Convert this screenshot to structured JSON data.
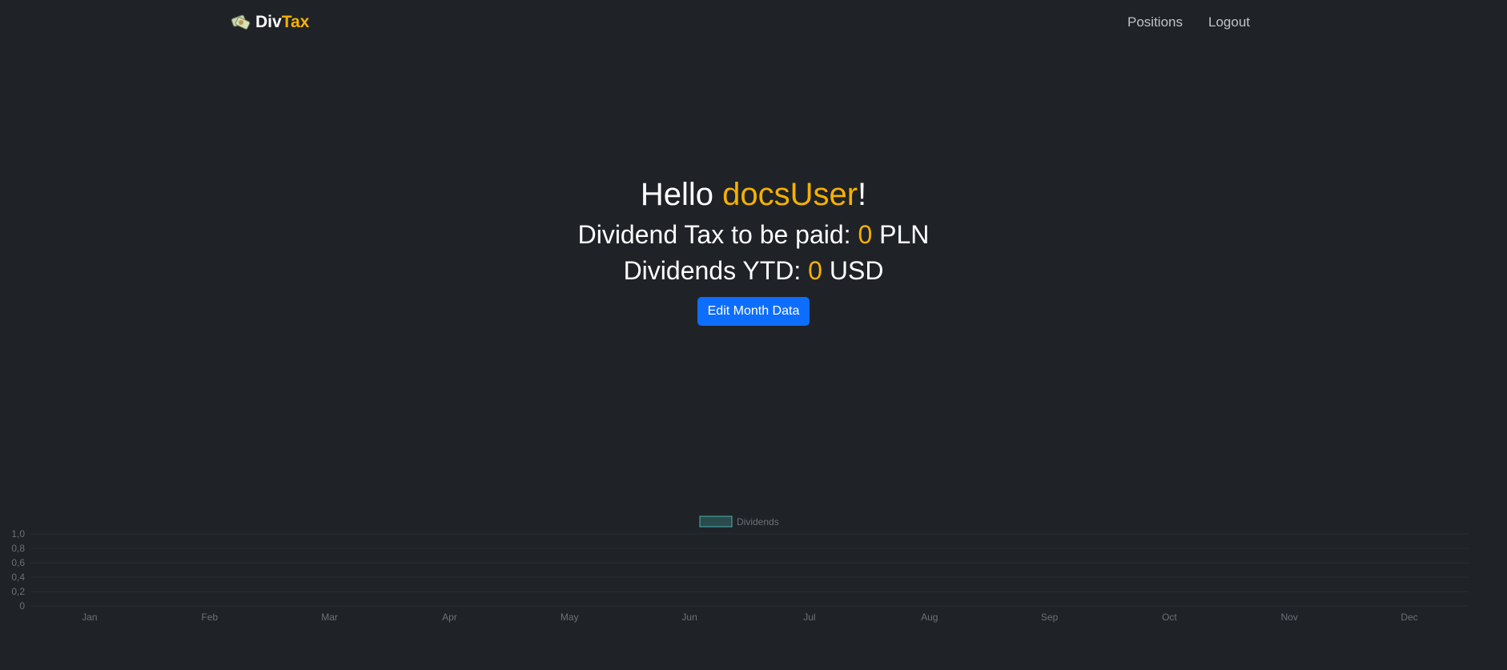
{
  "navbar": {
    "brand_part1": "Div",
    "brand_part2": "Tax",
    "logo_icon": "money-bundle-icon",
    "links": [
      {
        "label": "Positions"
      },
      {
        "label": "Logout"
      }
    ]
  },
  "hero": {
    "greeting_prefix": "Hello ",
    "username": "docsUser",
    "greeting_suffix": "!",
    "tax_prefix": "Dividend Tax to be paid: ",
    "tax_value": "0",
    "tax_currency": " PLN",
    "ytd_prefix": "Dividends YTD: ",
    "ytd_value": "0",
    "ytd_currency": " USD",
    "edit_button": "Edit Month Data"
  },
  "colors": {
    "background": "#1f2227",
    "accent": "#f5b100",
    "primary_button": "#0d6efd",
    "series_border": "#4bb3b3",
    "series_fill": "#2a4a4c"
  },
  "chart_data": {
    "type": "bar",
    "categories": [
      "Jan",
      "Feb",
      "Mar",
      "Apr",
      "May",
      "Jun",
      "Jul",
      "Aug",
      "Sep",
      "Oct",
      "Nov",
      "Dec"
    ],
    "series": [
      {
        "name": "Dividends",
        "values": [
          0,
          0,
          0,
          0,
          0,
          0,
          0,
          0,
          0,
          0,
          0,
          0
        ]
      }
    ],
    "yticks": [
      "1,0",
      "0,8",
      "0,6",
      "0,4",
      "0,2",
      "0"
    ],
    "ylim": [
      0,
      1
    ],
    "legend": "top-center",
    "grid": true
  }
}
